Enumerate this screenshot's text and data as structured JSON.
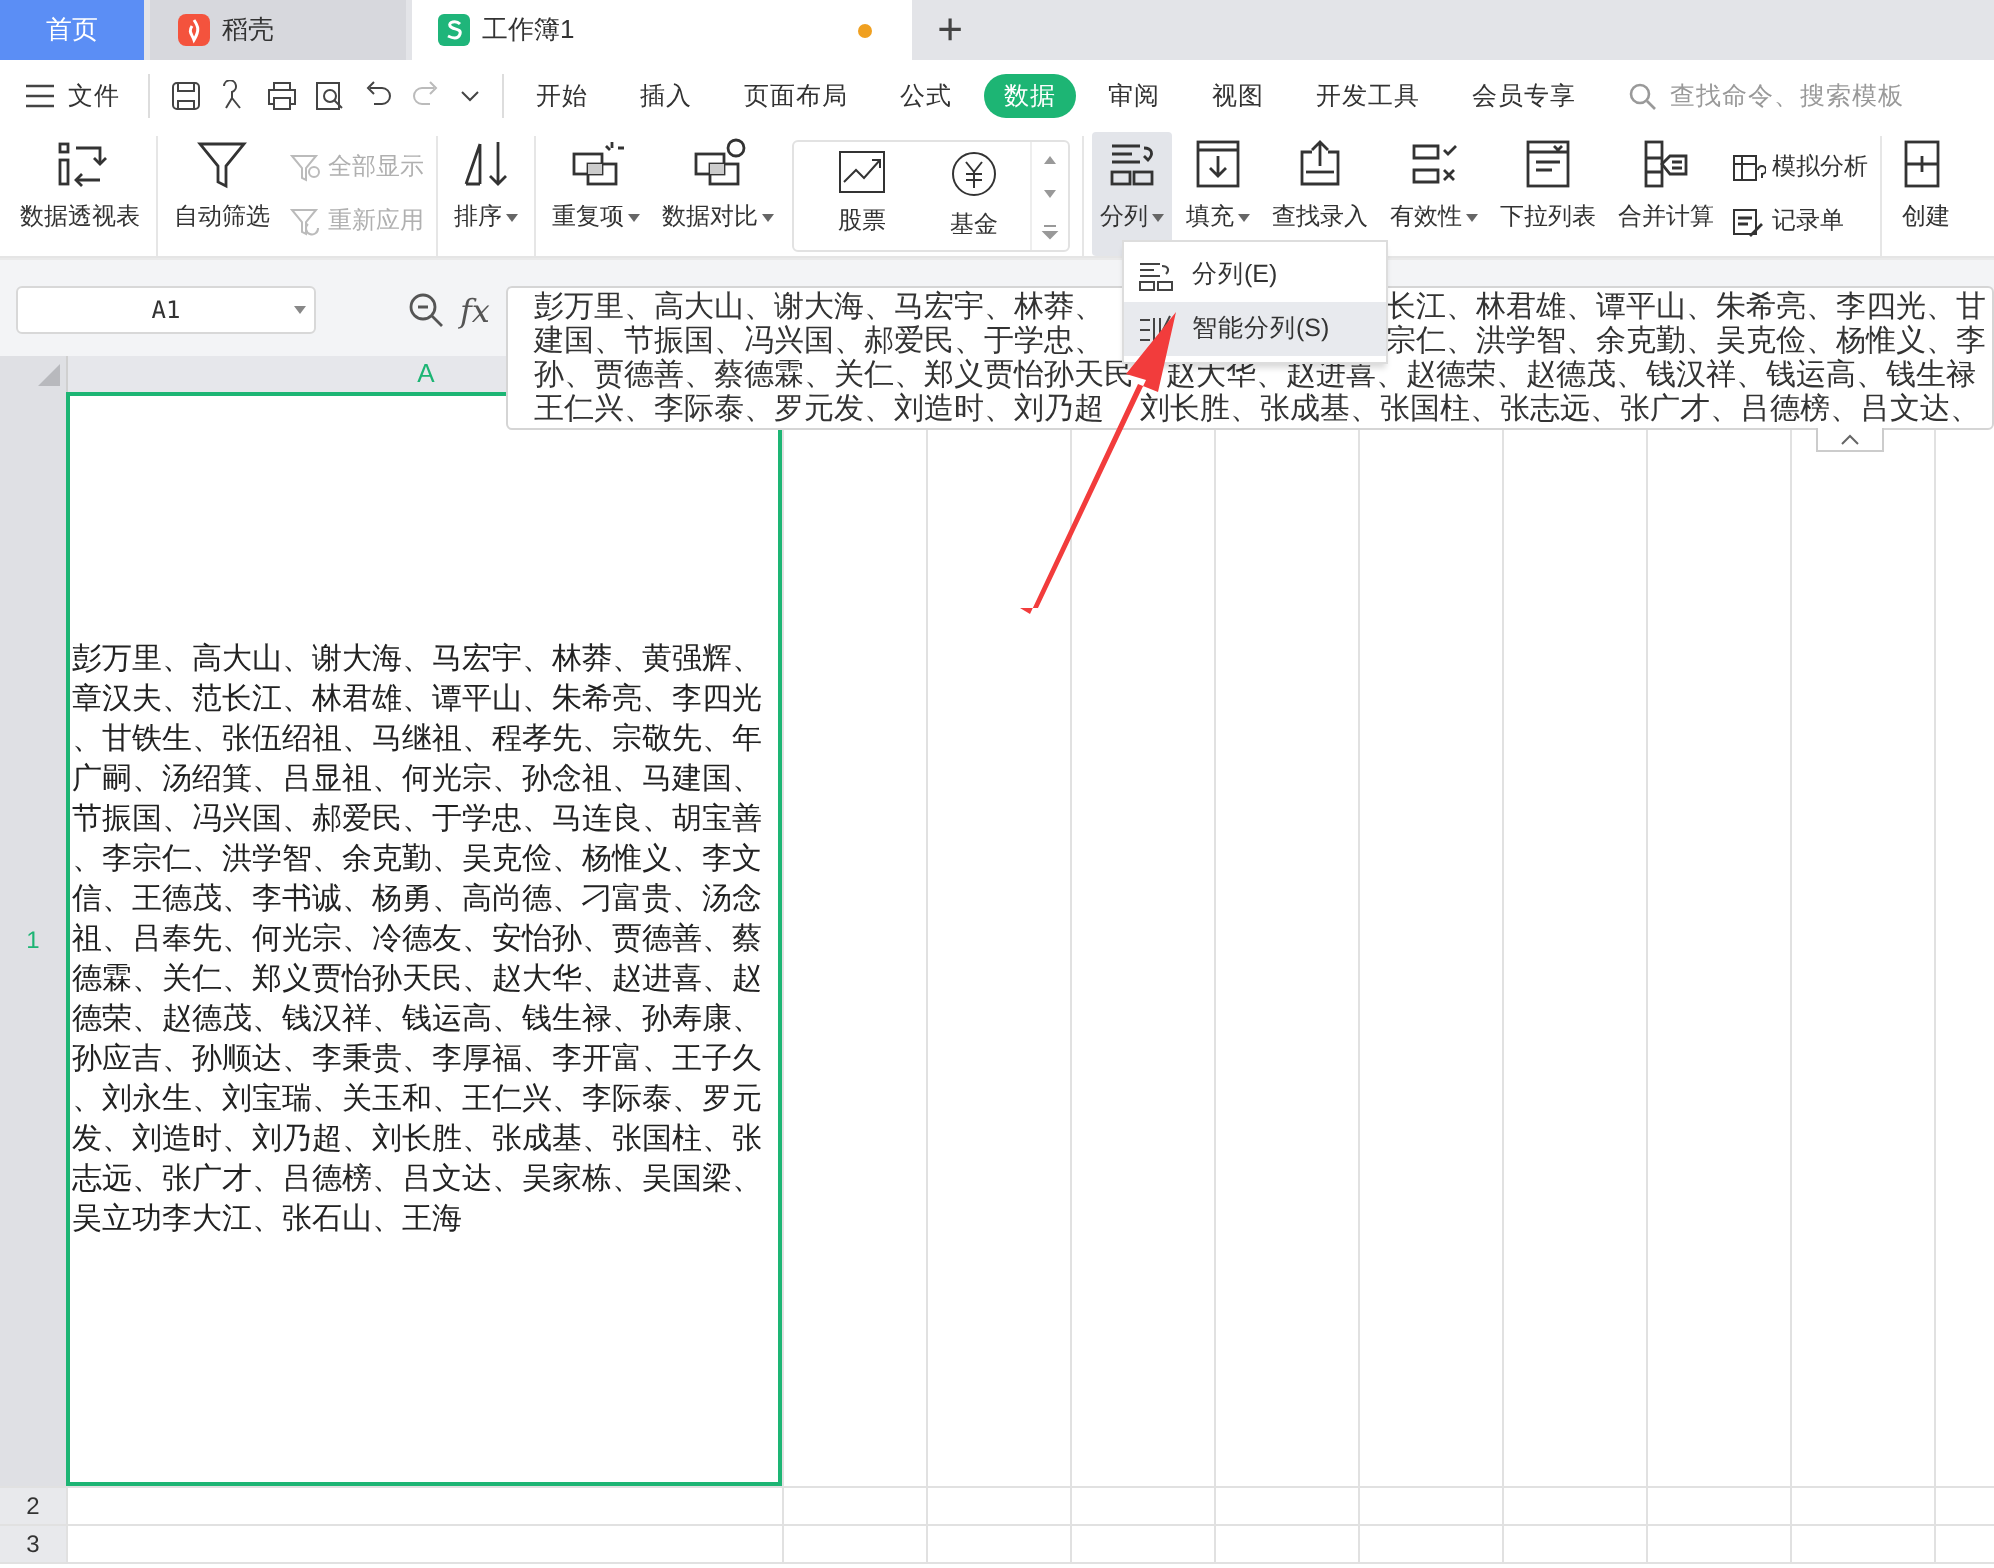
{
  "tabs": [
    {
      "label": "首页",
      "kind": "home",
      "selected": false,
      "modified": false
    },
    {
      "label": "稻壳",
      "kind": "docer",
      "selected": false,
      "modified": false
    },
    {
      "label": "工作簿1",
      "kind": "sheet",
      "selected": true,
      "modified": true
    }
  ],
  "new_tab": "+",
  "menu": {
    "file": "文件",
    "tabs": [
      {
        "label": "开始",
        "selected": false
      },
      {
        "label": "插入",
        "selected": false
      },
      {
        "label": "页面布局",
        "selected": false
      },
      {
        "label": "公式",
        "selected": false
      },
      {
        "label": "数据",
        "selected": true
      },
      {
        "label": "审阅",
        "selected": false
      },
      {
        "label": "视图",
        "selected": false
      },
      {
        "label": "开发工具",
        "selected": false
      },
      {
        "label": "会员专享",
        "selected": false
      }
    ],
    "search_placeholder": "查找命令、搜索模板"
  },
  "ribbon": [
    {
      "items": [
        {
          "kind": "large",
          "label": "数据透视表",
          "dropdown": false,
          "pressed": false
        }
      ]
    },
    {
      "items": [
        {
          "kind": "large",
          "label": "自动筛选",
          "dropdown": false,
          "pressed": false
        },
        {
          "kind": "stack",
          "items": [
            {
              "label": "全部显示",
              "disabled": true
            },
            {
              "label": "重新应用",
              "disabled": true
            }
          ]
        }
      ]
    },
    {
      "items": [
        {
          "kind": "large",
          "label": "排序",
          "dropdown": true,
          "pressed": false
        }
      ]
    },
    {
      "items": [
        {
          "kind": "large",
          "label": "重复项",
          "dropdown": true,
          "pressed": false
        },
        {
          "kind": "large",
          "label": "数据对比",
          "dropdown": true,
          "pressed": false
        },
        {
          "kind": "gallery",
          "items": [
            {
              "label": "股票"
            },
            {
              "label": "基金"
            }
          ]
        }
      ]
    },
    {
      "items": [
        {
          "kind": "large",
          "label": "分列",
          "dropdown": true,
          "pressed": true
        },
        {
          "kind": "large",
          "label": "填充",
          "dropdown": true,
          "pressed": false
        },
        {
          "kind": "large",
          "label": "查找录入",
          "dropdown": false,
          "pressed": false
        },
        {
          "kind": "large",
          "label": "有效性",
          "dropdown": true,
          "pressed": false
        },
        {
          "kind": "large",
          "label": "下拉列表",
          "dropdown": false,
          "pressed": false
        },
        {
          "kind": "large",
          "label": "合并计算",
          "dropdown": false,
          "pressed": false
        },
        {
          "kind": "stack",
          "items": [
            {
              "label": "模拟分析",
              "disabled": false
            },
            {
              "label": "记录单",
              "disabled": false
            }
          ]
        }
      ]
    },
    {
      "items": [
        {
          "kind": "large",
          "label": "创建",
          "dropdown": false,
          "pressed": false
        }
      ]
    }
  ],
  "context_menu": [
    {
      "label": "分列(E)",
      "selected": false
    },
    {
      "label": "智能分列(S)",
      "selected": true
    }
  ],
  "formula_bar": {
    "name_box": "A1",
    "function_label": "fx",
    "lines": [
      {
        "left": "彭万里、高大山、谢大海、马宏宇、林莽、",
        "right": "长江、林君雄、谭平山、朱希亮、李四光、甘"
      },
      {
        "left": "建国、节振国、冯兴国、郝爱民、于学忠、",
        "right": "宗仁、洪学智、余克勤、吴克俭、杨惟义、李"
      },
      {
        "left": "孙、贾德善、蔡德霖、关仁、郑义贾怡孙天民",
        "right": "赵大华、赵进喜、赵德荣、赵德茂、钱汉祥、钱运高、钱生禄"
      },
      {
        "left": "王仁兴、李际泰、罗元发、刘造时、刘乃超",
        "right": "刘长胜、张成基、张国柱、张志远、张广才、吕德榜、吕文达、"
      }
    ]
  },
  "sheet": {
    "columns": [
      {
        "label": "A",
        "selected": true
      }
    ],
    "rows": [
      {
        "label": "1",
        "selected": true
      },
      {
        "label": "2",
        "selected": false
      },
      {
        "label": "3",
        "selected": false
      }
    ],
    "cell_a1": "彭万里、高大山、谢大海、马宏宇、林莽、黄强辉、章汉夫、范长江、林君雄、谭平山、朱希亮、李四光、甘铁生、张伍绍祖、马继祖、程孝先、宗敬先、年广嗣、汤绍箕、吕显祖、何光宗、孙念祖、马建国、节振国、冯兴国、郝爱民、于学忠、马连良、胡宝善、李宗仁、洪学智、余克勤、吴克俭、杨惟义、李文信、王德茂、李书诚、杨勇、高尚德、刁富贵、汤念祖、吕奉先、何光宗、冷德友、安怡孙、贾德善、蔡德霖、关仁、郑义贾怡孙天民、赵大华、赵进喜、赵德荣、赵德茂、钱汉祥、钱运高、钱生禄、孙寿康、孙应吉、孙顺达、李秉贵、李厚福、李开富、王子久、刘永生、刘宝瑞、关玉和、王仁兴、李际泰、罗元发、刘造时、刘乃超、刘长胜、张成基、张国柱、张志远、张广才、吕德榜、吕文达、吴家栋、吴国梁、吴立功李大江、张石山、王海"
  }
}
